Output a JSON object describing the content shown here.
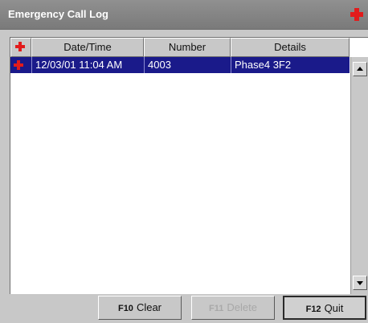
{
  "window": {
    "title": "Emergency Call Log"
  },
  "table": {
    "columns": [
      "Date/Time",
      "Number",
      "Details"
    ],
    "rows": [
      {
        "datetime": "12/03/01 11:04 AM",
        "number": "4003",
        "details": "Phase4 3F2",
        "selected": true
      }
    ]
  },
  "buttons": {
    "clear": {
      "key": "F10",
      "label": "Clear"
    },
    "delete": {
      "key": "F11",
      "label": "Delete"
    },
    "quit": {
      "key": "F12",
      "label": "Quit"
    }
  },
  "colors": {
    "selection": "#1a1a8a",
    "cross": "#e21b1b",
    "titlebar": "#7f7f7f"
  },
  "icons": {
    "title": "red-cross-icon",
    "header": "red-cross-icon",
    "row": "red-cross-icon"
  }
}
